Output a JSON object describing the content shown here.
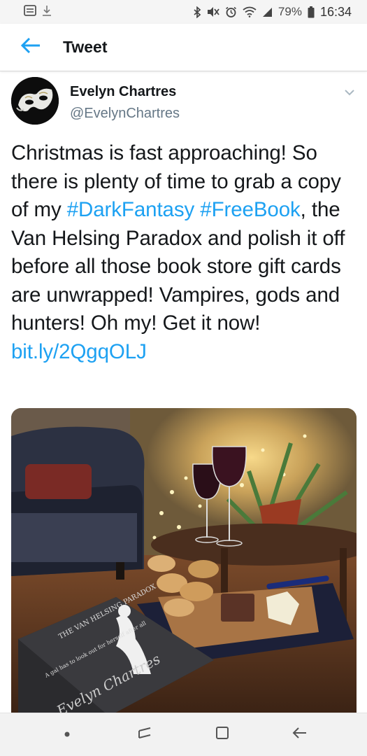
{
  "status_bar": {
    "battery_percent": "79%",
    "time": "16:34",
    "left_icons": [
      "notification-icon",
      "download-icon"
    ],
    "right_icons": [
      "bluetooth-icon",
      "mute-icon",
      "alarm-icon",
      "wifi-icon",
      "signal-icon",
      "battery-icon"
    ]
  },
  "header": {
    "back_icon": "arrow-left-icon",
    "title": "Tweet"
  },
  "tweet": {
    "author_name": "Evelyn Chartres",
    "author_handle": "@EvelynChartres",
    "text_before": "Christmas is fast approaching! So there is plenty of time to grab a copy of my ",
    "hashtag_1": "#DarkFantasy",
    "hashtag_2": "#FreeBook",
    "text_middle": ", the Van Helsing Paradox and polish it off before all those book store gift cards are unwrapped! Vampires, gods and hunters! Oh my! Get it now! ",
    "link": "bit.ly/2QgqOLJ",
    "image_text": {
      "book_title": "THE VAN HELSING PARADOX",
      "book_tagline": "A gal has to look out for herself after all",
      "book_author": "Evelyn Chartres"
    }
  },
  "nav_bar": {
    "buttons": [
      "dot-icon",
      "recents-icon",
      "home-icon",
      "back-icon"
    ]
  },
  "colors": {
    "accent": "#1da1f2",
    "text": "#14171a",
    "secondary_text": "#657786",
    "status_bar_bg": "#f5f5f5",
    "nav_bar_bg": "#f2f2f2"
  }
}
